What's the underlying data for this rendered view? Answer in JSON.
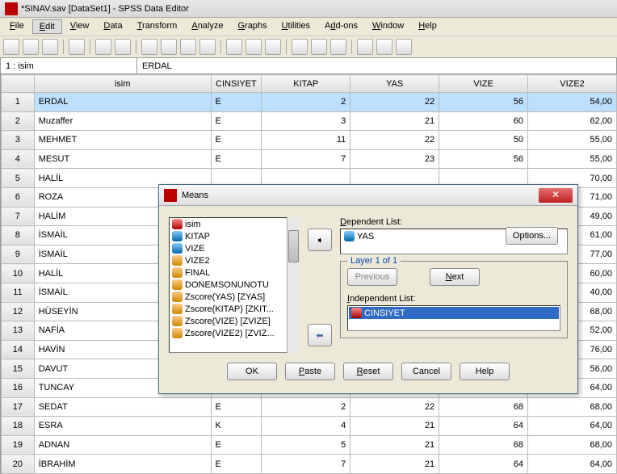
{
  "window": {
    "title": "*SINAV.sav [DataSet1] - SPSS Data Editor"
  },
  "menu": {
    "file": "File",
    "edit": "Edit",
    "view": "View",
    "data": "Data",
    "transform": "Transform",
    "analyze": "Analyze",
    "graphs": "Graphs",
    "utilities": "Utilities",
    "addons": "Add-ons",
    "window": "Window",
    "help": "Help"
  },
  "addr": {
    "label": "1 : isim",
    "value": "ERDAL"
  },
  "columns": {
    "rowhdr": "",
    "isim": "isim",
    "cinsiyet": "CINSIYET",
    "kitap": "KITAP",
    "yas": "YAS",
    "vize": "VIZE",
    "vize2": "VIZE2"
  },
  "rows": [
    {
      "n": "1",
      "isim": "ERDAL",
      "cin": "E",
      "kitap": "2",
      "yas": "22",
      "vize": "56",
      "vize2": "54,00"
    },
    {
      "n": "2",
      "isim": "Muzaffer",
      "cin": "E",
      "kitap": "3",
      "yas": "21",
      "vize": "60",
      "vize2": "62,00"
    },
    {
      "n": "3",
      "isim": "MEHMET",
      "cin": "E",
      "kitap": "11",
      "yas": "22",
      "vize": "50",
      "vize2": "55,00"
    },
    {
      "n": "4",
      "isim": "MESUT",
      "cin": "E",
      "kitap": "7",
      "yas": "23",
      "vize": "56",
      "vize2": "55,00"
    },
    {
      "n": "5",
      "isim": "HALİL",
      "cin": "",
      "kitap": "",
      "yas": "",
      "vize": "",
      "vize2": "70,00"
    },
    {
      "n": "6",
      "isim": "ROZA",
      "cin": "",
      "kitap": "",
      "yas": "",
      "vize": "",
      "vize2": "71,00"
    },
    {
      "n": "7",
      "isim": "HALİM",
      "cin": "",
      "kitap": "",
      "yas": "",
      "vize": "",
      "vize2": "49,00"
    },
    {
      "n": "8",
      "isim": "İSMAİL",
      "cin": "",
      "kitap": "",
      "yas": "",
      "vize": "",
      "vize2": "61,00"
    },
    {
      "n": "9",
      "isim": "İSMAİL",
      "cin": "",
      "kitap": "",
      "yas": "",
      "vize": "",
      "vize2": "77,00"
    },
    {
      "n": "10",
      "isim": "HALİL",
      "cin": "",
      "kitap": "",
      "yas": "",
      "vize": "",
      "vize2": "60,00"
    },
    {
      "n": "11",
      "isim": "İSMAİL",
      "cin": "",
      "kitap": "",
      "yas": "",
      "vize": "",
      "vize2": "40,00"
    },
    {
      "n": "12",
      "isim": "HÜSEYİN",
      "cin": "",
      "kitap": "",
      "yas": "",
      "vize": "",
      "vize2": "68,00"
    },
    {
      "n": "13",
      "isim": "NAFİA",
      "cin": "",
      "kitap": "",
      "yas": "",
      "vize": "",
      "vize2": "52,00"
    },
    {
      "n": "14",
      "isim": "HAVİN",
      "cin": "",
      "kitap": "",
      "yas": "",
      "vize": "",
      "vize2": "76,00"
    },
    {
      "n": "15",
      "isim": "DAVUT",
      "cin": "",
      "kitap": "",
      "yas": "",
      "vize": "",
      "vize2": "56,00"
    },
    {
      "n": "16",
      "isim": "TUNCAY",
      "cin": "",
      "kitap": "",
      "yas": "",
      "vize": "",
      "vize2": "64,00"
    },
    {
      "n": "17",
      "isim": "SEDAT",
      "cin": "E",
      "kitap": "2",
      "yas": "22",
      "vize": "68",
      "vize2": "68,00"
    },
    {
      "n": "18",
      "isim": "ESRA",
      "cin": "K",
      "kitap": "4",
      "yas": "21",
      "vize": "64",
      "vize2": "64,00"
    },
    {
      "n": "19",
      "isim": "ADNAN",
      "cin": "E",
      "kitap": "5",
      "yas": "21",
      "vize": "68",
      "vize2": "68,00"
    },
    {
      "n": "20",
      "isim": "İBRAHİM",
      "cin": "E",
      "kitap": "7",
      "yas": "21",
      "vize": "64",
      "vize2": "64,00"
    }
  ],
  "dialog": {
    "title": "Means",
    "options": "Options...",
    "dep_label": "Dependent List:",
    "dep_value": "YAS",
    "layer_label": "Layer 1 of 1",
    "prev": "Previous",
    "next": "Next",
    "ind_label": "Independent List:",
    "ind_value": "CINSIYET",
    "vars": [
      "isim",
      "KITAP",
      "VIZE",
      "VIZE2",
      "FINAL",
      "DONEMSONUNOTU",
      "Zscore(YAS) [ZYAS]",
      "Zscore(KITAP) [ZKIT...",
      "Zscore(VIZE) [ZVIZE]",
      "Zscore(VIZE2) [ZVIZ..."
    ],
    "buttons": {
      "ok": "OK",
      "paste": "Paste",
      "reset": "Reset",
      "cancel": "Cancel",
      "help": "Help"
    }
  }
}
